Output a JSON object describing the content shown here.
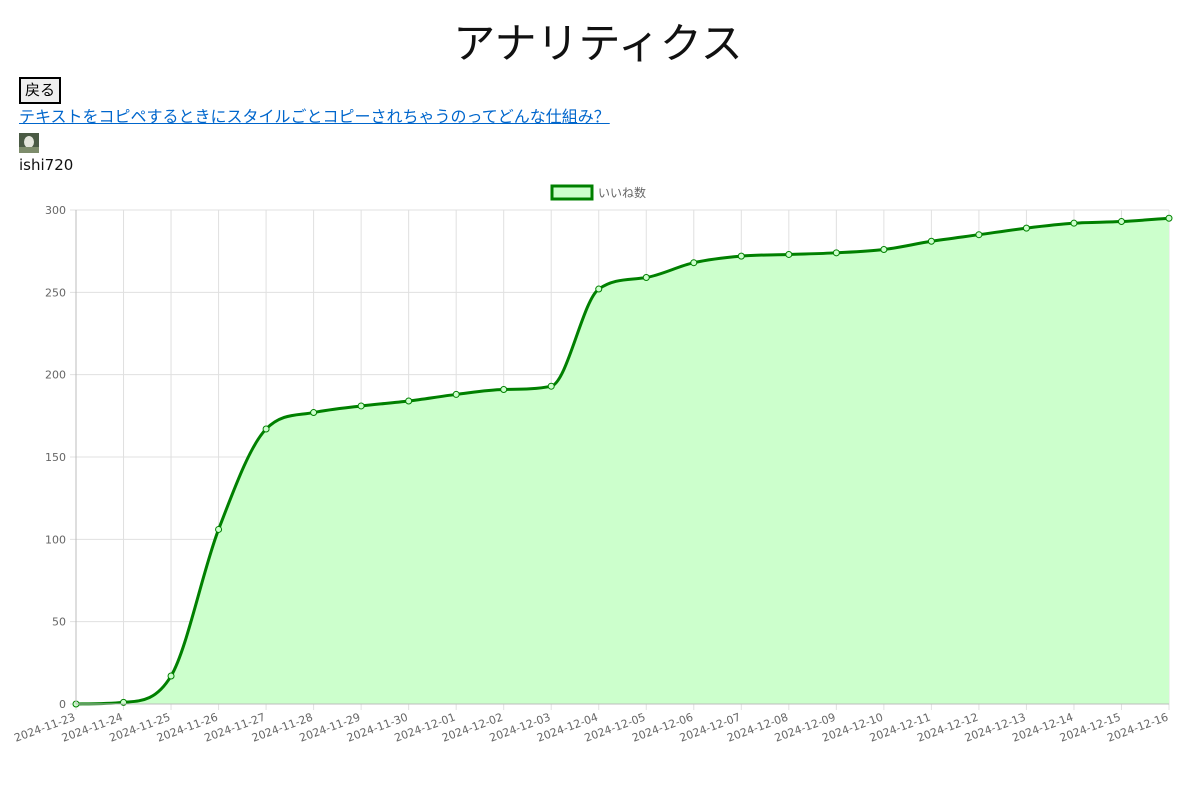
{
  "page": {
    "title": "アナリティクス",
    "back_label": "戻る",
    "article_link_text": "テキストをコピペするときにスタイルごとコピーされちゃうのってどんな仕組み？",
    "username": "ishi720"
  },
  "colors": {
    "line": "#008000",
    "fill": "#ccffcc",
    "grid": "#e0e0e0",
    "tick_text": "#666666",
    "link": "#0066cc"
  },
  "chart_data": {
    "type": "line",
    "title": "",
    "xlabel": "",
    "ylabel": "",
    "ylim": [
      0,
      300
    ],
    "yticks": [
      0,
      50,
      100,
      150,
      200,
      250,
      300
    ],
    "grid": true,
    "legend_position": "top-center",
    "categories": [
      "2024-11-23",
      "2024-11-24",
      "2024-11-25",
      "2024-11-26",
      "2024-11-27",
      "2024-11-28",
      "2024-11-29",
      "2024-11-30",
      "2024-12-01",
      "2024-12-02",
      "2024-12-03",
      "2024-12-04",
      "2024-12-05",
      "2024-12-06",
      "2024-12-07",
      "2024-12-08",
      "2024-12-09",
      "2024-12-10",
      "2024-12-11",
      "2024-12-12",
      "2024-12-13",
      "2024-12-14",
      "2024-12-15",
      "2024-12-16"
    ],
    "series": [
      {
        "name": "いいね数",
        "filled": true,
        "values": [
          0,
          1,
          17,
          106,
          167,
          177,
          181,
          184,
          188,
          191,
          193,
          252,
          259,
          268,
          272,
          273,
          274,
          276,
          281,
          285,
          289,
          292,
          293,
          295
        ]
      }
    ]
  }
}
